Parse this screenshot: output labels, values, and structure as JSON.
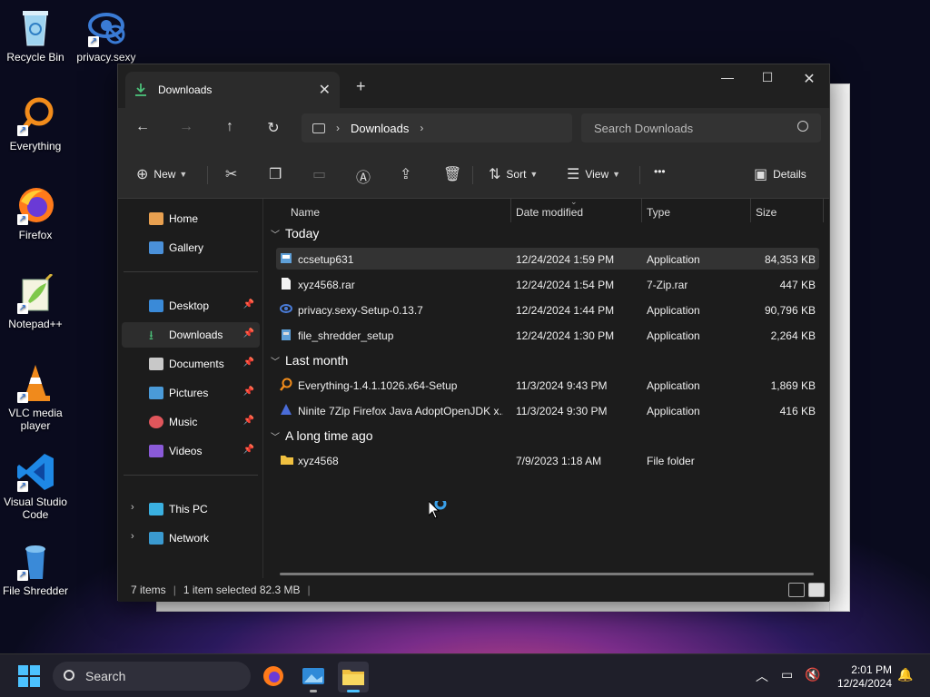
{
  "desktop": {
    "icons": [
      {
        "label": "Recycle Bin"
      },
      {
        "label": "privacy.sexy"
      },
      {
        "label": "Everything"
      },
      {
        "label": "Firefox"
      },
      {
        "label": "Notepad++"
      },
      {
        "label": "VLC media player"
      },
      {
        "label": "Visual Studio Code"
      },
      {
        "label": "File Shredder"
      }
    ]
  },
  "window": {
    "tab_title": "Downloads",
    "new_tab": "+",
    "minimize": "—",
    "maximize": "☐",
    "close": "✕",
    "address": {
      "crumb": "Downloads"
    },
    "search": {
      "placeholder": "Search Downloads"
    },
    "toolbar": {
      "new_label": "New",
      "sort_label": "Sort",
      "view_label": "View",
      "more_label": "•••",
      "details_label": "Details"
    },
    "sidebar": {
      "items": [
        {
          "label": "Home"
        },
        {
          "label": "Gallery"
        },
        {
          "label": "Desktop"
        },
        {
          "label": "Downloads"
        },
        {
          "label": "Documents"
        },
        {
          "label": "Pictures"
        },
        {
          "label": "Music"
        },
        {
          "label": "Videos"
        },
        {
          "label": "This PC"
        },
        {
          "label": "Network"
        }
      ]
    },
    "columns": {
      "name": "Name",
      "date": "Date modified",
      "type": "Type",
      "size": "Size"
    },
    "groups": [
      {
        "title": "Today",
        "rows": [
          {
            "name": "ccsetup631",
            "date": "12/24/2024 1:59 PM",
            "type": "Application",
            "size": "84,353 KB"
          },
          {
            "name": "xyz4568.rar",
            "date": "12/24/2024 1:54 PM",
            "type": "7-Zip.rar",
            "size": "447 KB"
          },
          {
            "name": "privacy.sexy-Setup-0.13.7",
            "date": "12/24/2024 1:44 PM",
            "type": "Application",
            "size": "90,796 KB"
          },
          {
            "name": "file_shredder_setup",
            "date": "12/24/2024 1:30 PM",
            "type": "Application",
            "size": "2,264 KB"
          }
        ]
      },
      {
        "title": "Last month",
        "rows": [
          {
            "name": "Everything-1.4.1.1026.x64-Setup",
            "date": "11/3/2024 9:43 PM",
            "type": "Application",
            "size": "1,869 KB"
          },
          {
            "name": "Ninite 7Zip Firefox Java AdoptOpenJDK x...",
            "date": "11/3/2024 9:30 PM",
            "type": "Application",
            "size": "416 KB"
          }
        ]
      },
      {
        "title": "A long time ago",
        "rows": [
          {
            "name": "xyz4568",
            "date": "7/9/2023 1:18 AM",
            "type": "File folder",
            "size": ""
          }
        ]
      }
    ],
    "status": {
      "items": "7 items",
      "selected": "1 item selected  82.3 MB"
    }
  },
  "taskbar": {
    "search_label": "Search",
    "time": "2:01 PM",
    "date": "12/24/2024"
  },
  "colors": {
    "accent": "#4cc2ff",
    "selection": "#333333",
    "window_bg": "#1c1c1c"
  }
}
